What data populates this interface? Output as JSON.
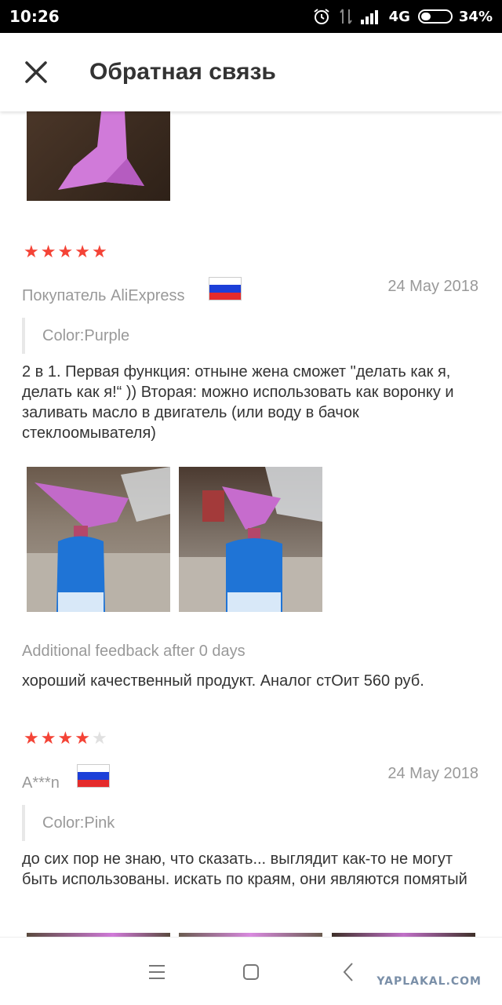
{
  "status_bar": {
    "time": "10:26",
    "network": "4G",
    "battery": "34%",
    "battery_level": 0.34
  },
  "header": {
    "title": "Обратная связь",
    "close_icon": "close-icon"
  },
  "reviews": [
    {
      "rating": 5,
      "max_rating": 5,
      "buyer": "Покупатель AliExpress",
      "country_flag": "russia-flag",
      "date": "24 May 2018",
      "attribute": "Color:Purple",
      "text": "2 в 1. Первая функция: отныне жена сможет \"делать как я, делать как я!“ )) Вторая: можно использовать как воронку и заливать масло в двигатель (или воду в бачок стеклоомывателя)",
      "additional_label": "Additional feedback after 0 days",
      "additional_text": "хороший качественный продукт. Аналог стОит 560 руб."
    },
    {
      "rating": 4,
      "max_rating": 5,
      "buyer": "A***n",
      "country_flag": "russia-flag",
      "date": "24 May 2018",
      "attribute": "Color:Pink",
      "text": "до сих пор не знаю, что сказать... выглядит как-то не могут быть использованы. искать по краям, они являются помятый"
    }
  ],
  "colors": {
    "star_active": "#f44336",
    "star_inactive": "#e0e0e0",
    "muted_text": "#999999",
    "body_text": "#333333"
  },
  "navigation": {
    "menu_icon": "menu-icon",
    "home_icon": "home-square-icon",
    "back_icon": "back-chevron-icon"
  },
  "watermark": "YAPLAKAL.COM"
}
